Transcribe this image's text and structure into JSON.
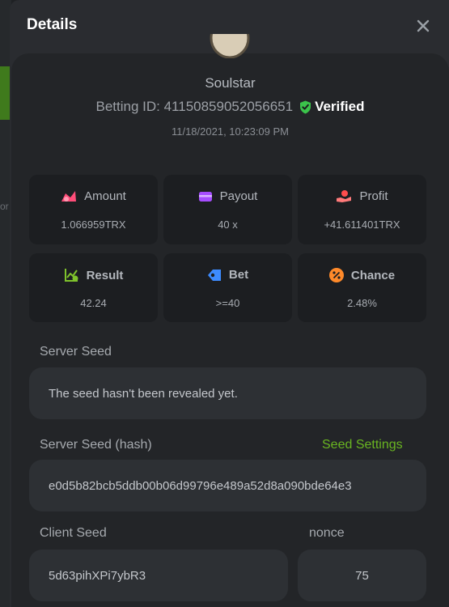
{
  "modal": {
    "title": "Details"
  },
  "user": {
    "name": "Soulstar"
  },
  "bet": {
    "id_label": "Betting ID: 41150859052056651",
    "verified_label": "Verified",
    "datetime": "11/18/2021, 10:23:09 PM"
  },
  "stats": [
    {
      "label": "Amount",
      "value": "1.066959TRX",
      "icon": "coins-icon",
      "color": "#ff4d79"
    },
    {
      "label": "Payout",
      "value": "40 x",
      "icon": "wallet-icon",
      "color": "#a64dff"
    },
    {
      "label": "Profit",
      "value": "+41.611401TRX",
      "icon": "money-hand-icon",
      "color": "#ff4d4d"
    },
    {
      "label": "Result",
      "value": "42.24",
      "icon": "chart-check-icon",
      "color": "#7fc32c"
    },
    {
      "label": "Bet",
      "value": ">=40",
      "icon": "tag-icon",
      "color": "#3d8bff"
    },
    {
      "label": "Chance",
      "value": "2.48%",
      "icon": "percent-icon",
      "color": "#ff8a2a"
    }
  ],
  "server_seed": {
    "label": "Server Seed",
    "value": "The seed hasn't been revealed yet."
  },
  "server_seed_hash": {
    "label": "Server Seed (hash)",
    "value": "e0d5b82bcb5ddb00b06d99796e489a52d8a090bde64e3",
    "settings_link": "Seed Settings"
  },
  "client_seed": {
    "label": "Client Seed",
    "value": "5d63pihXPi7ybR3"
  },
  "nonce": {
    "label": "nonce",
    "value": "75"
  },
  "colors": {
    "accent_green": "#69b521",
    "verified_green": "#3bc44b"
  }
}
